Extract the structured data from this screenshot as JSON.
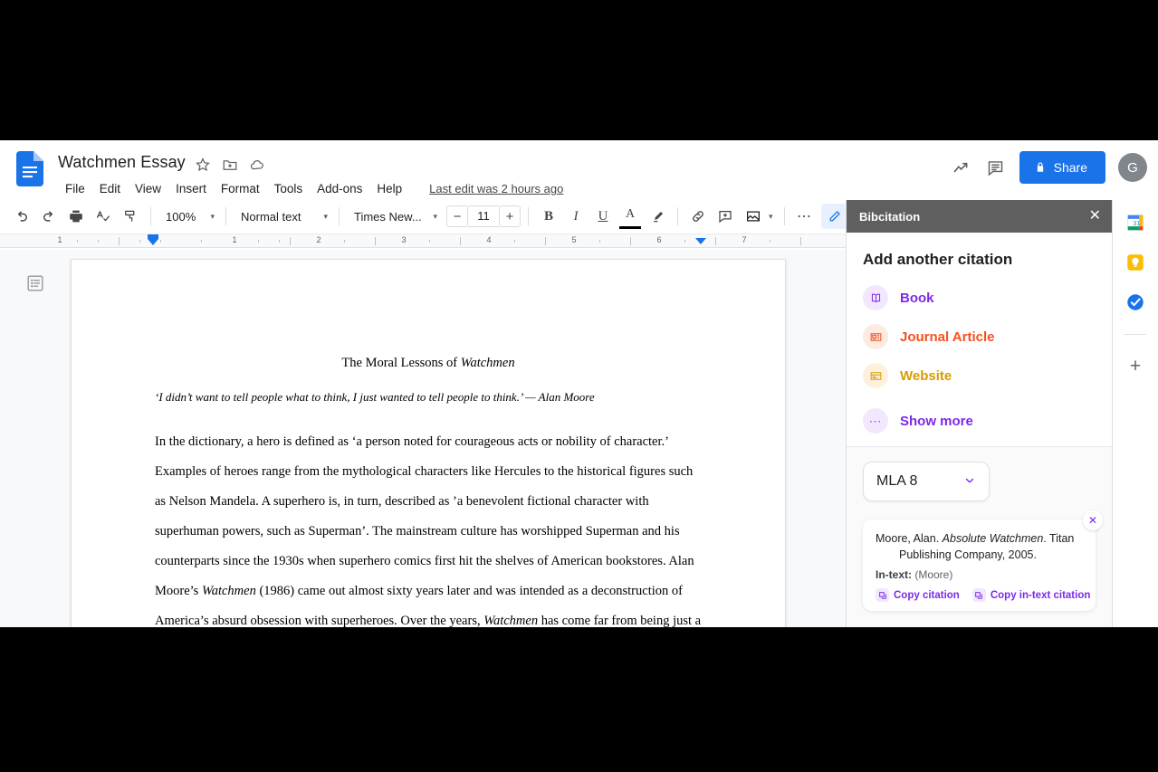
{
  "header": {
    "doc_title": "Watchmen Essay",
    "title_icons": [
      "star-icon",
      "move-to-folder-icon",
      "cloud-saved-icon"
    ],
    "menus": [
      "File",
      "Edit",
      "View",
      "Insert",
      "Format",
      "Tools",
      "Add-ons",
      "Help"
    ],
    "last_edit": "Last edit was 2 hours ago",
    "share_label": "Share",
    "avatar_initial": "G",
    "right_icons": [
      "trending-up-icon",
      "comment-history-icon"
    ]
  },
  "toolbar": {
    "zoom": "100%",
    "style": "Normal text",
    "font": "Times New...",
    "font_size": "11",
    "decrease_label": "−",
    "increase_label": "+",
    "bold": "B",
    "italic": "I",
    "underline": "U",
    "text_color": "A",
    "caret": "▾"
  },
  "ruler": {
    "numbers": [
      "1",
      "1",
      "2",
      "3",
      "4",
      "5",
      "6",
      "7"
    ]
  },
  "document": {
    "title_plain": "The Moral Lessons of ",
    "title_italic": "Watchmen",
    "epigraph": "‘I didn’t want to tell people what to think, I just wanted to tell people to think.’ — Alan Moore",
    "paragraph": [
      {
        "t": "In the dictionary, a hero is defined as ‘a person noted for courageous acts or nobility of character.’"
      },
      {
        "t": "Examples of heroes range from the mythological characters like Hercules to the historical figures such as"
      },
      {
        "t": "Nelson Mandela. A superhero is, in turn, described as ’a benevolent fictional character with superhuman"
      },
      {
        "t": "powers, such as Superman’. The mainstream culture has worshipped Superman and his counterparts since"
      },
      {
        "t": "the 1930s when superhero comics first hit the shelves of American bookstores. Alan Moore’s ",
        "i": "Watchmen"
      },
      {
        "t": "(1986) came out almost sixty years later and was intended as a deconstruction of America’s absurd"
      },
      {
        "t": "obsession with superheroes. Over the years, ",
        "i": "Watchmen",
        "t2": " has come far from being just a rebuke of the"
      }
    ]
  },
  "sidepanel": {
    "title": "Bibcitation",
    "close": "✕",
    "heading": "Add another citation",
    "types": [
      {
        "label": "Book",
        "icon": "book-icon",
        "color": "#7c2ae8"
      },
      {
        "label": "Journal Article",
        "icon": "journal-icon",
        "color": "#f4511e"
      },
      {
        "label": "Website",
        "icon": "website-icon",
        "color": "#d79b00"
      },
      {
        "label": "Show more",
        "icon": "ellipsis-icon",
        "color": "#7c2ae8"
      }
    ],
    "style_selected": "MLA 8",
    "citation": {
      "part1": "Moore, Alan. ",
      "italic1": "Absolute Watchmen",
      "part2": ". Titan Publishing Company, 2005.",
      "intext_label": "In-text: ",
      "intext_value": "(Moore)",
      "copy_citation": "Copy citation",
      "copy_intext": "Copy in-text citation",
      "close": "✕"
    }
  },
  "rail": {
    "icons": [
      "google-calendar-icon",
      "google-keep-icon",
      "google-tasks-icon"
    ],
    "plus": "+"
  }
}
